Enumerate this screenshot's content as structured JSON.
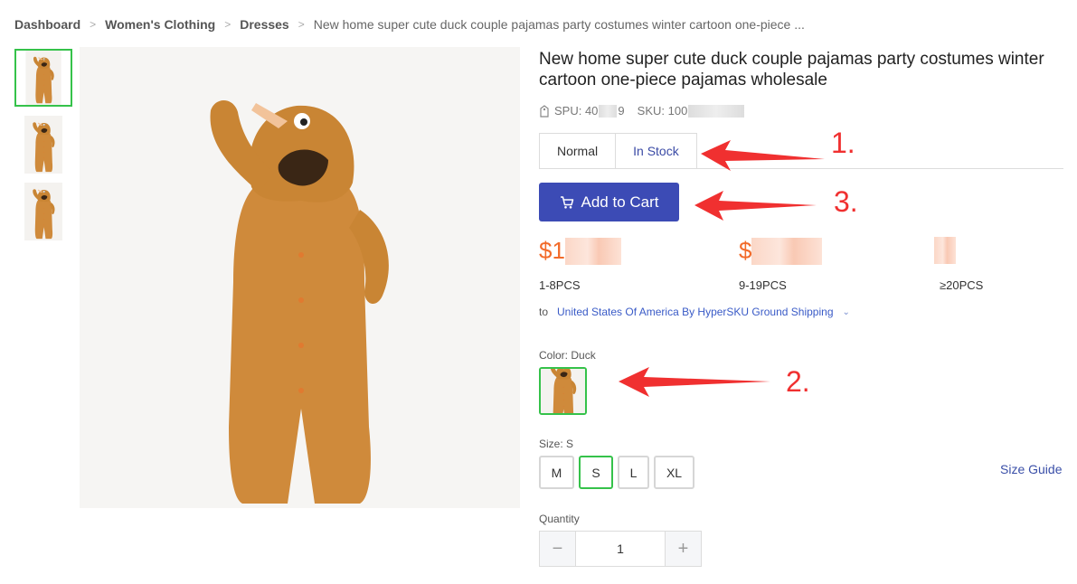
{
  "breadcrumb": {
    "items": [
      "Dashboard",
      "Women's Clothing",
      "Dresses"
    ],
    "current": "New home super cute duck couple pajamas party costumes winter cartoon one-piece ..."
  },
  "product": {
    "title": "New home super cute duck couple pajamas party costumes winter cartoon one-piece pajamas wholesale",
    "spu_label": "SPU: 40",
    "spu_tail": "9",
    "sku_label": "SKU: 100"
  },
  "tabs": [
    {
      "label": "Normal",
      "active": false
    },
    {
      "label": "In Stock",
      "active": true
    }
  ],
  "cart": {
    "label": "Add to Cart",
    "icon": "cart-icon"
  },
  "prices": [
    {
      "visible": "$1",
      "range": "1-8PCS"
    },
    {
      "visible": "$",
      "range": "9-19PCS"
    },
    {
      "visible": "",
      "range": "≥20PCS"
    }
  ],
  "shipping": {
    "to_label": "to",
    "method": "United States Of America By HyperSKU Ground Shipping"
  },
  "color": {
    "label": "Color:",
    "value": "Duck"
  },
  "size": {
    "label": "Size:",
    "value": "S",
    "options": [
      "M",
      "S",
      "L",
      "XL"
    ],
    "guide": "Size Guide"
  },
  "quantity": {
    "label": "Quantity",
    "value": "1"
  },
  "annotations": [
    "1.",
    "2.",
    "3."
  ],
  "colors": {
    "accent": "#3c4bb5",
    "selected": "#35c24a",
    "price": "#f26b2a",
    "arrow": "#f03030"
  }
}
